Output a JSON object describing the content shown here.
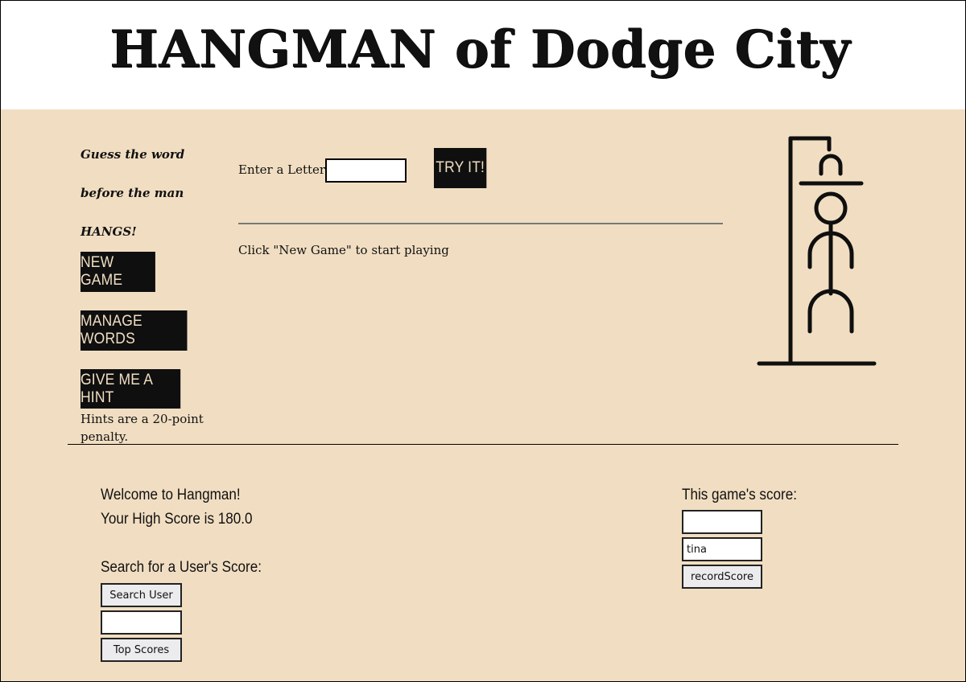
{
  "header": {
    "title": "HANGMAN of Dodge City"
  },
  "sidebar": {
    "tagline": [
      "Guess the word",
      "before the man",
      "HANGS!"
    ],
    "new_game_label": "NEW GAME",
    "manage_words_label": "MANAGE WORDS",
    "hint_label": "GIVE ME A HINT",
    "hint_note": "Hints are a 20-point penalty."
  },
  "game": {
    "enter_letter_label": "Enter a Letter:",
    "letter_value": "",
    "try_label": "TRY IT!",
    "status_message": "Click \"New Game\" to start playing"
  },
  "scores": {
    "welcome": "Welcome to Hangman!",
    "high_score": "Your High Score is 180.0",
    "search_heading": "Search for a User's Score:",
    "search_user_label": "Search User",
    "search_value": "",
    "top_scores_label": "Top Scores",
    "game_score_heading": "This game's score:",
    "game_score_value": "",
    "username_value": "tina",
    "record_label": "recordScore"
  },
  "icons": {
    "gallows": "hangman-gallows-icon"
  }
}
